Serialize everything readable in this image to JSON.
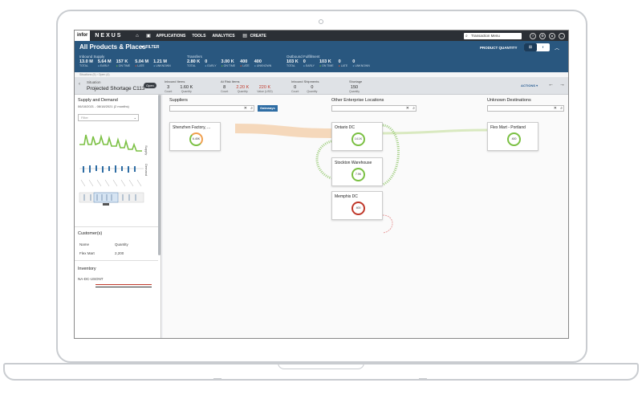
{
  "topbar": {
    "logo": "infor",
    "brand": "NEXUS",
    "nav": [
      "APPLICATIONS",
      "TOOLS",
      "ANALYTICS",
      "CREATE"
    ],
    "search_value": "Transaction Menu"
  },
  "header": {
    "title": "All Products & Places",
    "filter_label": "FILTER",
    "product_quantity_label": "PRODUCT QUANTITY",
    "groups": [
      {
        "label": "Inbound Supply",
        "metrics": [
          {
            "value": "13.0 M",
            "label": "TOTAL",
            "dot": ""
          },
          {
            "value": "5.64 M",
            "label": "EARLY",
            "dot": "b"
          },
          {
            "value": "157 K",
            "label": "ON TIME",
            "dot": "g"
          },
          {
            "value": "5.04 M",
            "label": "LATE",
            "dot": "r"
          },
          {
            "value": "1.21 M",
            "label": "UNKNOWN",
            "dot": "b"
          }
        ]
      },
      {
        "label": "Transfers",
        "metrics": [
          {
            "value": "2.80 K",
            "label": "TOTAL",
            "dot": ""
          },
          {
            "value": "0",
            "label": "EARLY",
            "dot": "b"
          },
          {
            "value": "3.00 K",
            "label": "ON TIME",
            "dot": "g"
          },
          {
            "value": "400",
            "label": "LATE",
            "dot": "r"
          },
          {
            "value": "400",
            "label": "UNKNOWN",
            "dot": "b"
          }
        ]
      },
      {
        "label": "Outbound Fulfillment",
        "metrics": [
          {
            "value": "103 K",
            "label": "TOTAL",
            "dot": ""
          },
          {
            "value": "0",
            "label": "EARLY",
            "dot": "b"
          },
          {
            "value": "103 K",
            "label": "ON TIME",
            "dot": "g"
          },
          {
            "value": "0",
            "label": "LATE",
            "dot": "r"
          },
          {
            "value": "0",
            "label": "UNKNOWN",
            "dot": "b"
          }
        ]
      }
    ]
  },
  "breadcrumb": "Situations (5) › Open (4)",
  "situation": {
    "label": "Situation",
    "name": "Projected Shortage C113",
    "status": "Open",
    "boxes": [
      {
        "title": "Inbound Items",
        "cells": [
          {
            "v": "3",
            "l": "Count",
            "red": false
          },
          {
            "v": "1.60 K",
            "l": "Quantity",
            "red": false
          }
        ]
      },
      {
        "title": "At Risk Items",
        "cells": [
          {
            "v": "8",
            "l": "Count",
            "red": false
          },
          {
            "v": "2.20 K",
            "l": "Quantity",
            "red": true
          },
          {
            "v": "220 K",
            "l": "Value (USD)",
            "red": true
          }
        ]
      },
      {
        "title": "Inbound Shipments",
        "cells": [
          {
            "v": "0",
            "l": "Count",
            "red": false
          },
          {
            "v": "0",
            "l": "Quantity",
            "red": false
          }
        ]
      },
      {
        "title": "Shortage",
        "cells": [
          {
            "v": "150",
            "l": "Quantity",
            "red": false
          }
        ]
      }
    ],
    "actions_label": "ACTIONS"
  },
  "left_panel": {
    "title": "Supply and Demand",
    "date_range": "06/18/2021 - 08/18/2021 (2 months)",
    "filter_placeholder": "Filter",
    "supply_label": "Supply",
    "demand_label": "Demand",
    "customers_header": "Customer(s)",
    "col_name": "Name",
    "col_qty": "Quantity",
    "customer_name": "Flex Mart",
    "customer_qty": "2,200",
    "inventory_header": "Inventory",
    "inventory_item": "NA-DC-USONT"
  },
  "canvas": {
    "suppliers_header": "Suppliers",
    "other_header": "Other Enterprise Locations",
    "unknown_header": "Unknown Destinations",
    "gateways_label": "Gateways",
    "nodes": {
      "shenzhen": {
        "name": "Shenzhen Factory, ...",
        "value": "6.45K"
      },
      "ontario": {
        "name": "Ontario DC",
        "value": "14.1K"
      },
      "stockton": {
        "name": "Stockton Warehouse",
        "value": "7.9K"
      },
      "memphis": {
        "name": "Memphis DC",
        "value": "400"
      },
      "flexmart": {
        "name": "Flex Mart - Portland",
        "value": "400"
      }
    }
  },
  "colors": {
    "header_blue": "#29577f",
    "topbar": "#2b2f35",
    "ok_green": "#7bc043",
    "risk_red": "#c0392b",
    "flow_orange": "#f2c9a0"
  }
}
